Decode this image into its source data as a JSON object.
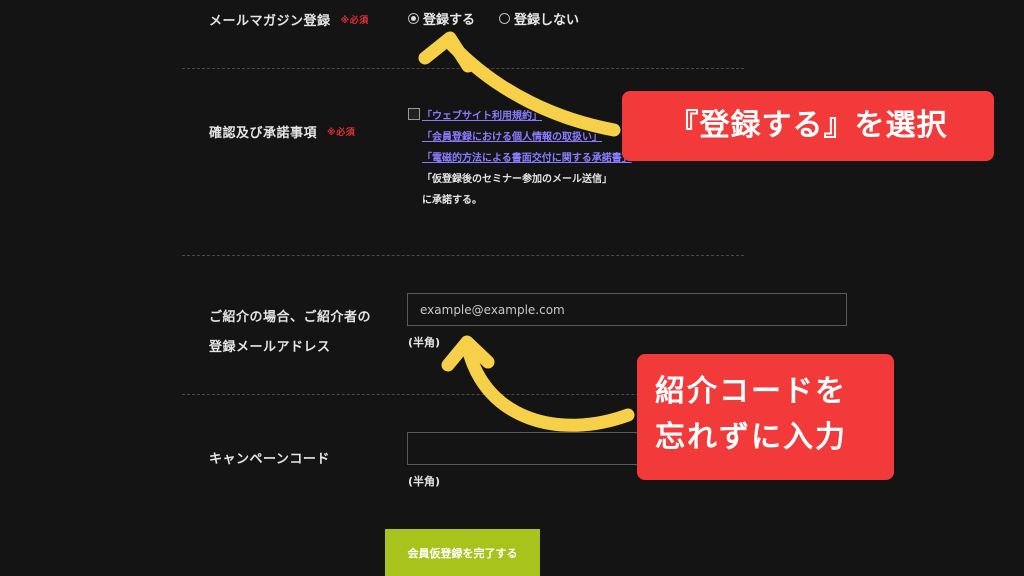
{
  "form": {
    "newsletter": {
      "label": "メールマガジン登録",
      "required": "※必須",
      "options": [
        {
          "label": "登録する",
          "checked": true
        },
        {
          "label": "登録しない",
          "checked": false
        }
      ]
    },
    "consent": {
      "label": "確認及び承諾事項",
      "required": "※必須",
      "links": [
        "「ウェブサイト利用規約」",
        "「会員登録における個人情報の取扱い」",
        "「電磁的方法による書面交付に関する承諾書」"
      ],
      "plain": "「仮登録後のセミナー参加のメール送信」",
      "suffix": "に承諾する。"
    },
    "referrer": {
      "label_line1": "ご紹介の場合、ご紹介者の",
      "label_line2": "登録メールアドレス",
      "placeholder": "example@example.com",
      "note": "(半角)"
    },
    "campaign": {
      "label": "キャンペーンコード",
      "placeholder": "",
      "note": "(半角)"
    },
    "submit_label": "会員仮登録を完了する"
  },
  "annotations": {
    "callout1": "『登録する』を選択",
    "callout2_line1": "紹介コードを",
    "callout2_line2": "忘れずに入力"
  },
  "colors": {
    "background": "#141414",
    "required": "#e0303a",
    "link": "#8a7cff",
    "submit": "#a8c31c",
    "callout": "#f23a3a",
    "arrow": "#f7d04a"
  }
}
